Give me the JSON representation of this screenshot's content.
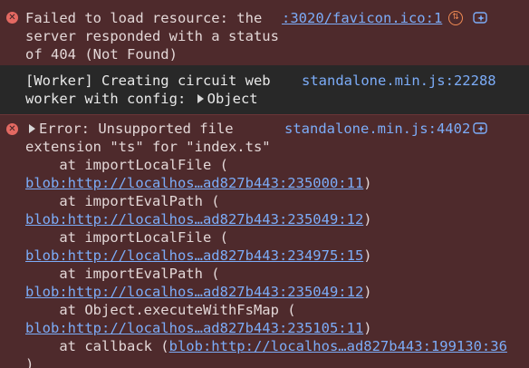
{
  "messages": [
    {
      "type": "error",
      "lines": [
        "Failed to load resource: the",
        "server responded with a status",
        "of 404 (Not Found)"
      ],
      "source": ":3020/favicon.ico:1"
    },
    {
      "type": "info",
      "lines": [
        "[Worker] Creating circuit web",
        "worker with config: "
      ],
      "object_label": "Object",
      "source": "standalone.min.js:22288"
    },
    {
      "type": "error",
      "lines": [
        "Error: Unsupported file",
        "extension \"ts\" for \"index.ts\""
      ],
      "source": "standalone.min.js:4402",
      "stack": [
        {
          "prefix": "    at importLocalFile (",
          "link": "blob:http://localhos…ad827b443:235000:11",
          "suffix": ")"
        },
        {
          "prefix": "    at importEvalPath (",
          "link": "blob:http://localhos…ad827b443:235049:12",
          "suffix": ")"
        },
        {
          "prefix": "    at importLocalFile (",
          "link": "blob:http://localhos…ad827b443:234975:15",
          "suffix": ")"
        },
        {
          "prefix": "    at importEvalPath (",
          "link": "blob:http://localhos…ad827b443:235049:12",
          "suffix": ")"
        },
        {
          "prefix": "    at Object.executeWithFsMap (",
          "link": "blob:http://localhos…ad827b443:235105:11",
          "suffix": ")"
        },
        {
          "prefix": "    at callback (",
          "link": "blob:http://localhos…ad827b443:199130:36",
          "suffix": ""
        },
        {
          "prefix": ")",
          "link": "",
          "suffix": ""
        }
      ]
    }
  ],
  "icons": {
    "error": "error-circle-icon",
    "network": "network-request-icon",
    "ai": "ai-assistance-icon",
    "expand": "expand-triangle-icon"
  },
  "colors": {
    "error_bg": "#4e2a2c",
    "info_bg": "#282828",
    "link": "#7cacf8",
    "error_icon": "#e46962"
  }
}
